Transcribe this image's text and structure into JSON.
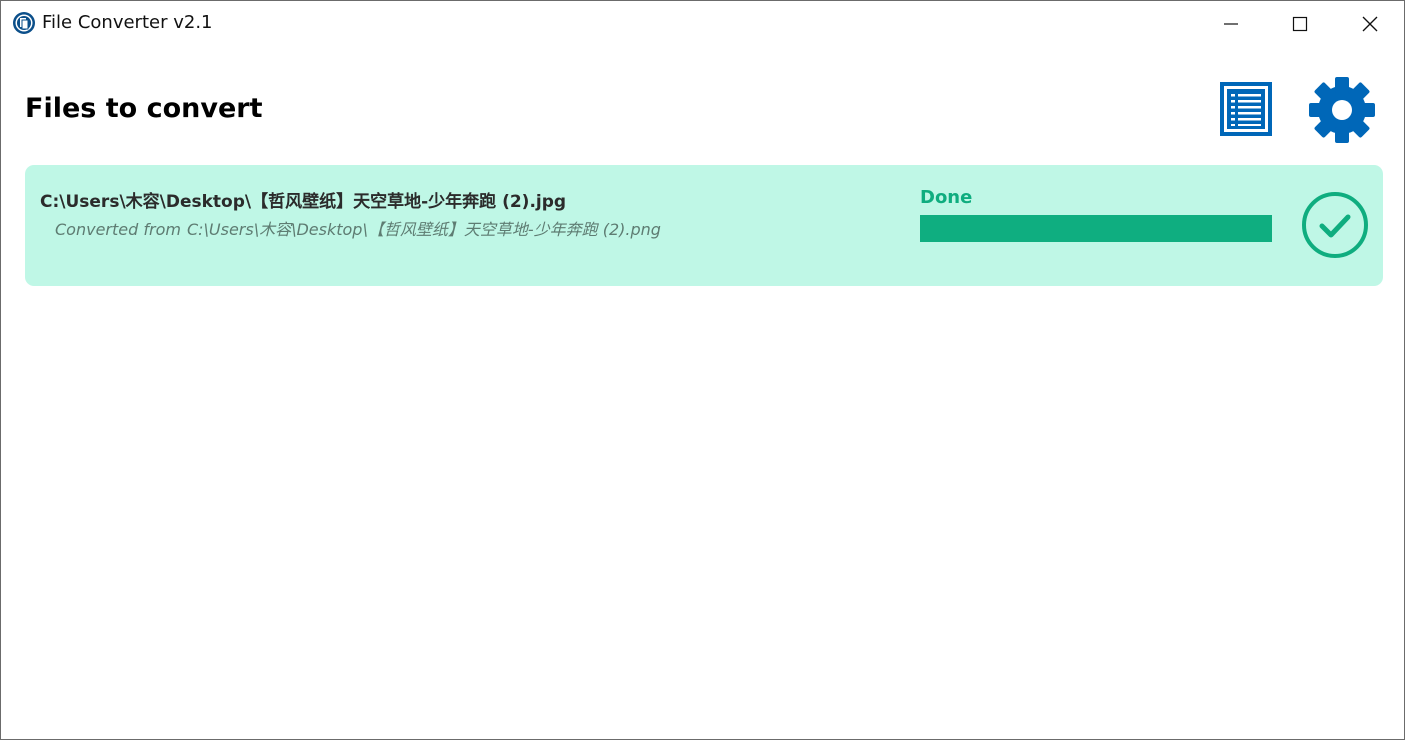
{
  "window": {
    "title": "File Converter v2.1"
  },
  "header": {
    "title": "Files to convert"
  },
  "files": [
    {
      "path": "C:\\Users\\木容\\Desktop\\【哲风壁纸】天空草地-少年奔跑 (2).jpg",
      "converted_label": "Converted from",
      "source_path": "C:\\Users\\木容\\Desktop\\【哲风壁纸】天空草地-少年奔跑 (2).png",
      "status": "Done",
      "progress": 1.0
    }
  ],
  "colors": {
    "accent": "#0067b8",
    "card_background": "#bff7e6",
    "success": "#0fad7f"
  },
  "icons": {
    "app": "file-converter-logo-icon",
    "history": "list-document-icon",
    "settings": "gear-icon",
    "done": "check-circle-icon"
  }
}
